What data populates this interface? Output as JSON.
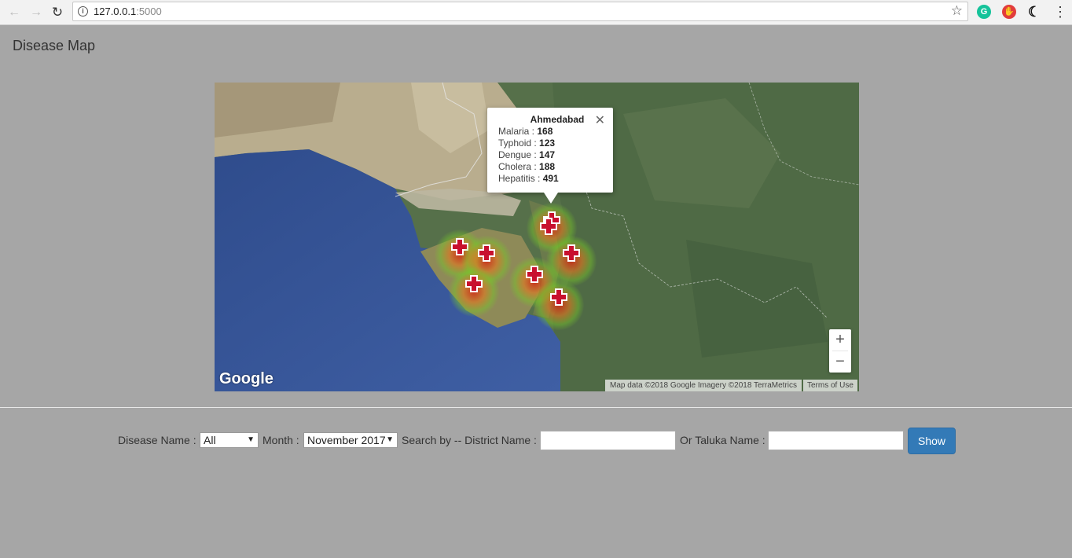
{
  "browser": {
    "url_host": "127.0.0.1",
    "url_port": ":5000",
    "extensions": [
      "grammarly-icon",
      "adblock-icon",
      "dark-mode-icon"
    ]
  },
  "page": {
    "title": "Disease Map"
  },
  "map": {
    "popup": {
      "title": "Ahmedabad",
      "rows": [
        {
          "label": "Malaria :",
          "value": "168"
        },
        {
          "label": "Typhoid :",
          "value": "123"
        },
        {
          "label": "Dengue :",
          "value": "147"
        },
        {
          "label": "Cholera :",
          "value": "188"
        },
        {
          "label": "Hepatitis :",
          "value": "491"
        }
      ]
    },
    "logo": "Google",
    "attribution": "Map data ©2018 Google Imagery ©2018 TerraMetrics",
    "terms": "Terms of Use",
    "zoom_in": "+",
    "zoom_out": "−"
  },
  "filters": {
    "disease_label": "Disease Name :",
    "disease_value": "All",
    "month_label": "Month :",
    "month_value": "November 2017",
    "district_label": "Search by -- District Name :",
    "district_value": "",
    "taluka_label": "Or Taluka Name :",
    "taluka_value": "",
    "show_button": "Show"
  }
}
